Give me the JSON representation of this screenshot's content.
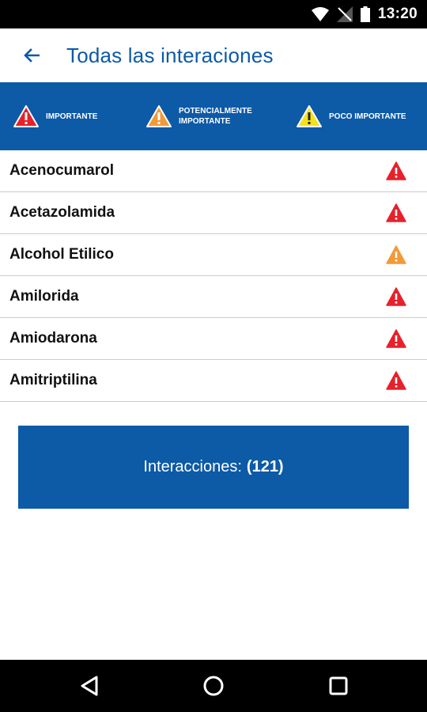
{
  "status_bar": {
    "time": "13:20"
  },
  "app_bar": {
    "title": "Todas las interaciones"
  },
  "legend": {
    "items": [
      {
        "label": "IMPORTANTE",
        "color": "#e8202a",
        "icon": "warning-red-icon"
      },
      {
        "label_line1": "POTENCIALMENTE",
        "label_line2": "IMPORTANTE",
        "color": "#f29a38",
        "icon": "warning-orange-icon"
      },
      {
        "label": "POCO IMPORTANTE",
        "color": "#f4e21a",
        "icon": "warning-yellow-icon"
      }
    ]
  },
  "interactions": [
    {
      "name": "Acenocumarol",
      "level": "importante",
      "color": "#e8202a"
    },
    {
      "name": "Acetazolamida",
      "level": "importante",
      "color": "#e8202a"
    },
    {
      "name": "Alcohol Etilico",
      "level": "potencialmente importante",
      "color": "#f29a38"
    },
    {
      "name": "Amilorida",
      "level": "importante",
      "color": "#e8202a"
    },
    {
      "name": "Amiodarona",
      "level": "importante",
      "color": "#e8202a"
    },
    {
      "name": "Amitriptilina",
      "level": "importante",
      "color": "#e8202a"
    }
  ],
  "count_button": {
    "label": "Interacciones:",
    "count": "(121)"
  },
  "colors": {
    "primary": "#0d5aa7"
  }
}
